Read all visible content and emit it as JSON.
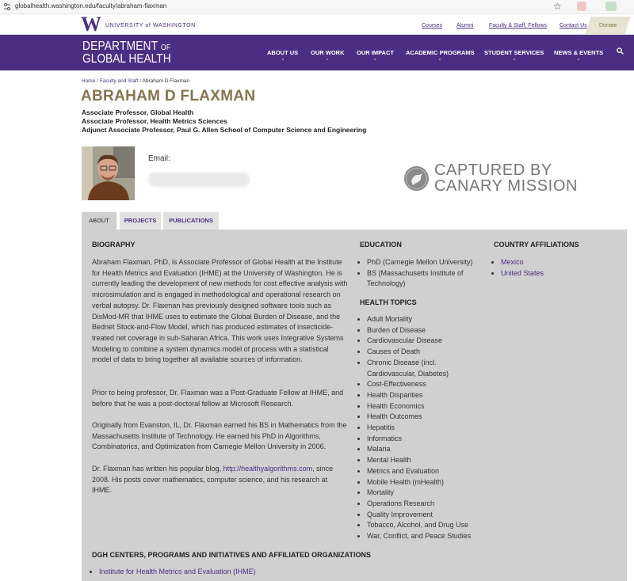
{
  "browser": {
    "url": "globalhealth.washington.edu/faculty/abraham-flaxman"
  },
  "uw": {
    "wordmark": "UNIVERSITY of WASHINGTON"
  },
  "toplinks": [
    "Courses",
    "Alumni",
    "Faculty & Staff, Fellows",
    "Contact Us",
    "Donate"
  ],
  "department": {
    "line1": "DEPARTMENT",
    "of": "OF",
    "line2": "GLOBAL HEALTH"
  },
  "nav": [
    "ABOUT US",
    "OUR WORK",
    "OUR IMPACT",
    "ACADEMIC PROGRAMS",
    "STUDENT SERVICES",
    "NEWS & EVENTS"
  ],
  "breadcrumb": {
    "home": "Home",
    "sep": " / ",
    "faculty": "Faculty and Staff",
    "current": "Abraham D Flaxman"
  },
  "person": {
    "name": "ABRAHAM D FLAXMAN",
    "titles": [
      "Associate Professor, Global Health",
      "Associate Professor, Health Metrics Sciences",
      "Adjunct Associate Professor, Paul G. Allen School of Computer Science and Engineering"
    ],
    "email_label": "Email:"
  },
  "watermark": {
    "line1": "CAPTURED BY",
    "line2": "CANARY MISSION"
  },
  "tabs": [
    "ABOUT",
    "PROJECTS",
    "PUBLICATIONS"
  ],
  "biography": {
    "heading": "BIOGRAPHY",
    "paragraphs": [
      "Abraham Flaxman, PhD, is Associate Professor of Global Health at the Institute for Health Metrics and Evaluation (IHME) at the University of Washington. He is currently leading the development of new methods for cost effective analysis with microsimulation and is engaged in methodological and operational research on verbal autopsy. Dr. Flaxman has previously designed software tools such as DisMod-MR that IHME uses to estimate the Global Burden of Disease, and the Bednet Stock-and-Flow Model, which has produced estimates of insecticide-treated net coverage in sub-Saharan Africa. This work uses Integrative Systems Modeling to combine a system dynamics model of process with a statistical model of data to bring together all available sources of information.",
      "Prior to being professor, Dr. Flaxman was a Post-Graduate Fellow at IHME, and before that he was a post-doctoral fellow at Microsoft Research.",
      "Originally from Evanston, IL, Dr. Flaxman earned his BS in Mathematics from the Massachusetts Institute of Technology. He earned his PhD in Algorithms, Combinatorics, and Optimization from Carnegie Mellon University in 2006."
    ],
    "blog_pre": "Dr. Flaxman has written his popular blog, ",
    "blog_link": "http://healthyalgorithms.com",
    "blog_post": ", since 2008. His posts cover mathematics, computer science, and his research at IHME."
  },
  "education": {
    "heading": "EDUCATION",
    "items": [
      "PhD (Carnegie Mellon University)",
      "BS (Massachusetts Institute of Technology)"
    ]
  },
  "health_topics": {
    "heading": "HEALTH TOPICS",
    "items": [
      "Adult Mortality",
      "Burden of Disease",
      "Cardiovascular Disease",
      "Causes of Death",
      "Chronic Disease (incl. Cardiovascular, Diabetes)",
      "Cost-Effectiveness",
      "Health Disparities",
      "Health Economics",
      "Health Outcomes",
      "Hepatitis",
      "Informatics",
      "Malaria",
      "Mental Health",
      "Metrics and Evaluation",
      "Mobile Health (mHealth)",
      "Mortality",
      "Operations Research",
      "Quality Improvement",
      "Tobacco, Alcohol, and Drug Use",
      "War, Conflict, and Peace Studies"
    ]
  },
  "country_affiliations": {
    "heading": "COUNTRY AFFILIATIONS",
    "items": [
      "Mexico",
      "United States"
    ]
  },
  "dgh_centers": {
    "heading": "DGH CENTERS, PROGRAMS AND INITIATIVES AND AFFILIATED ORGANIZATIONS",
    "items": [
      "Institute for Health Metrics and Evaluation (IHME)"
    ]
  },
  "colors": {
    "uw_purple": "#4b2e83",
    "uw_gold": "#85754d",
    "panel_gray": "#d0d0d0"
  }
}
